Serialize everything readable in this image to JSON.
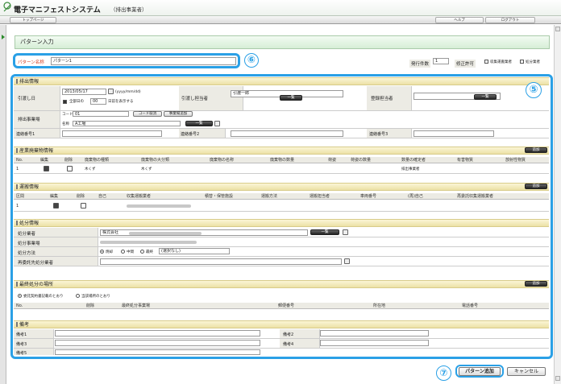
{
  "app": {
    "title": "電子マニフェストシステム",
    "subtitle": "（排出事業者）"
  },
  "nav": {
    "top": "トップページ",
    "help": "ヘルプ",
    "logout": "ログアウト"
  },
  "page": {
    "title": "パターン入力"
  },
  "pattern": {
    "label": "パターン名称",
    "value": "パターン1",
    "issue_label": "発行件数",
    "issue_value": "1",
    "correction_label": "修正許可",
    "opt1": "収集運搬業者",
    "opt2": "処分業者"
  },
  "haishutsu": {
    "title": "排出情報",
    "hikiwatashi_label": "引渡し日",
    "date": "2013/05/17",
    "date_fmt": "(yyyy/mm/dd)",
    "keika_label": "全部日の",
    "keika_sel": "00",
    "keika_suffix": "日前を表示する",
    "tantou_label": "引渡し担当者",
    "tantou_value": "引渡一郎",
    "ichiran": "一覧",
    "touroku_label": "登録担当者",
    "jigyojo_label": "排出事業場",
    "code_label": "コード",
    "code_value": "01",
    "code_clear": "コード取消",
    "jigyojo_add": "事業場追加",
    "name_label": "名称",
    "name_value": "A工場",
    "renraku1": "連絡番号1",
    "renraku2": "連絡番号2",
    "renraku3": "連絡番号3"
  },
  "sangyo": {
    "title": "産業廃棄物情報",
    "add": "追加",
    "cols": [
      "No.",
      "編集",
      "削除",
      "廃棄物の種類",
      "廃棄物の大分類",
      "廃棄物の名称",
      "廃棄物の数量",
      "荷姿",
      "荷姿の数量",
      "数量の確定者",
      "有害物質",
      "放射性物質"
    ],
    "row": {
      "no": "1",
      "type": "木くず",
      "cat": "木くず",
      "fixer": "排出事業者"
    }
  },
  "unpan": {
    "title": "運搬情報",
    "add": "追加",
    "cols": [
      "区間",
      "編集",
      "削除",
      "自己",
      "収集運搬業者",
      "積替・保管施設",
      "運搬方法",
      "運搬担当者",
      "車両番号",
      "(再)自己",
      "再委託収集運搬業者"
    ],
    "row": {
      "no": "1"
    }
  },
  "shobun": {
    "title": "処分情報",
    "gyosha_label": "処分業者",
    "gyosha_value": "株式会社",
    "ichiran": "一覧",
    "jigyojo_label": "処分事業場",
    "houhou_label": "処分方法",
    "m1": "焼却",
    "m2": "中間",
    "m3": "最終",
    "method_sel": "(選択なし)",
    "saiitaku_label": "再委託先処分業者"
  },
  "saishu": {
    "title": "最終処分の場所",
    "add": "追加",
    "r1": "委託契約書記載のとおり",
    "r2": "当該場所のとおり",
    "cols": [
      "No.",
      "削除",
      "最終処分事業場",
      "郵便番号",
      "所在地",
      "電話番号"
    ]
  },
  "bikou": {
    "title": "備考",
    "b1": "備考1",
    "b2": "備考2",
    "b3": "備考3",
    "b4": "備考4",
    "b5": "備考5"
  },
  "footer": {
    "add": "パターン追加",
    "cancel": "キャンセル"
  },
  "callouts": {
    "n5": "⑤",
    "n6": "⑥",
    "n7": "⑦"
  },
  "colors": {
    "accent": "#2aa0e6",
    "title_green": "#d6eed6",
    "section_yellow": "#ece1a6",
    "required_red": "#d23a1e"
  }
}
